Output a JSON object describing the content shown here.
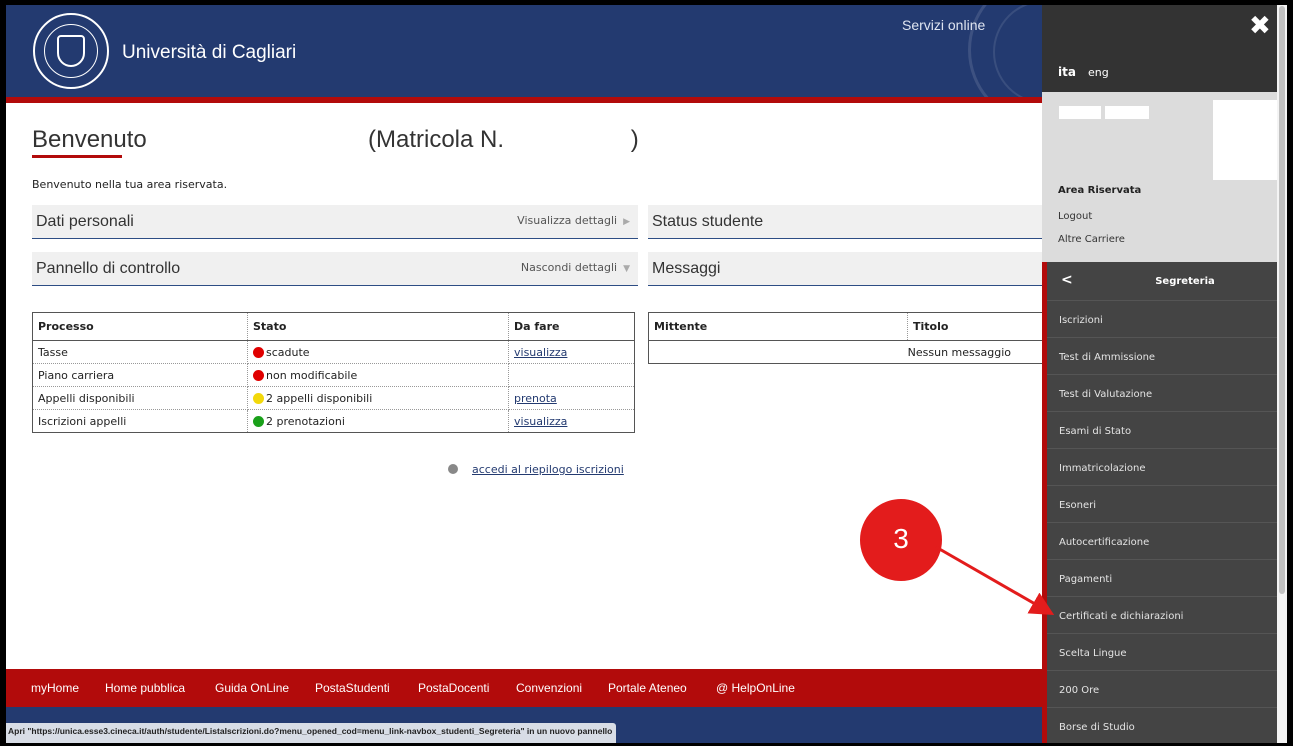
{
  "header": {
    "site_title": "Università di Cagliari",
    "servizi": "Servizi online"
  },
  "main": {
    "page_title": "Benvenuto",
    "matricola": "(Matricola N.                   )",
    "welcome": "Benvenuto nella tua area riservata.",
    "panels": {
      "dati_personali": {
        "title": "Dati personali",
        "toggle": "Visualizza dettagli"
      },
      "status_studente": {
        "title": "Status studente"
      },
      "pannello": {
        "title": "Pannello di controllo",
        "toggle": "Nascondi dettagli"
      },
      "messaggi": {
        "title": "Messaggi"
      }
    },
    "control_table": {
      "headers": [
        "Processo",
        "Stato",
        "Da fare"
      ],
      "rows": [
        {
          "processo": "Tasse",
          "stato": "scadute",
          "status_color": "#e00000",
          "azione": "visualizza"
        },
        {
          "processo": "Piano carriera",
          "stato": "non modificabile",
          "status_color": "#e00000",
          "azione": ""
        },
        {
          "processo": "Appelli disponibili",
          "stato": "2 appelli disponibili",
          "status_color": "#f2d80a",
          "azione": "prenota"
        },
        {
          "processo": "Iscrizioni appelli",
          "stato": "2 prenotazioni",
          "status_color": "#1aa01a",
          "azione": "visualizza"
        }
      ]
    },
    "riepilogo_link": "accedi al riepilogo iscrizioni",
    "messages_table": {
      "headers": [
        "Mittente",
        "Titolo"
      ],
      "empty": "Nessun messaggio"
    }
  },
  "footer": {
    "links": [
      "myHome",
      "Home pubblica",
      "Guida OnLine",
      "PostaStudenti",
      "PostaDocenti",
      "Convenzioni",
      "Portale Ateneo",
      "@ HelpOnLine"
    ]
  },
  "statusbar": "Apri \"https://unica.esse3.cineca.it/auth/studente/ListaIscrizioni.do?menu_opened_cod=menu_link-navbox_studenti_Segreteria\" in un nuovo pannello",
  "sidebar": {
    "close": "✖",
    "lang_active": "ita",
    "lang_other": "eng",
    "area_riservata": "Area Riservata",
    "logout": "Logout",
    "altre_carriere": "Altre Carriere",
    "back": "<",
    "section": "Segreteria",
    "items": [
      "Iscrizioni",
      "Test di Ammissione",
      "Test di Valutazione",
      "Esami di Stato",
      "Immatricolazione",
      "Esoneri",
      "Autocertificazione",
      "Pagamenti",
      "Certificati e dichiarazioni",
      "Scelta Lingue",
      "200 Ore",
      "Borse di Studio"
    ]
  },
  "annotation": {
    "number": "3",
    "color": "#e31c1c"
  }
}
